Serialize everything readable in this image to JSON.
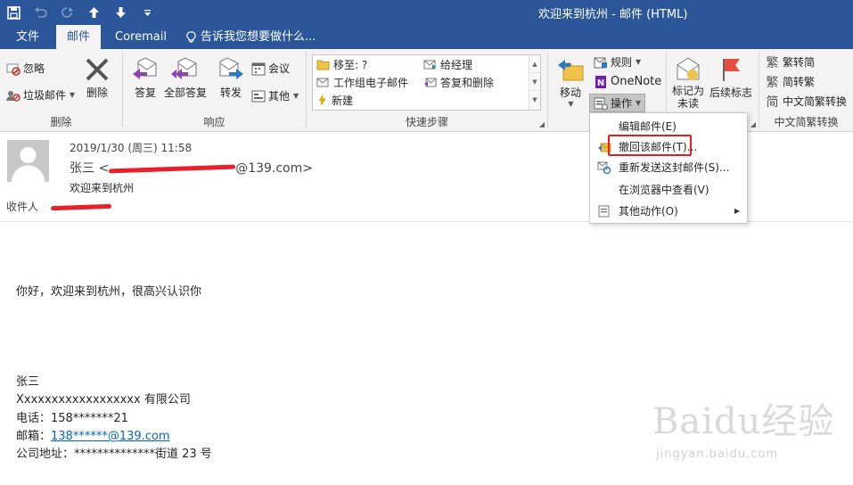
{
  "window": {
    "title": "欢迎来到杭州 - 邮件 (HTML)"
  },
  "qat": {
    "save": "save",
    "undo": "undo",
    "redo": "redo",
    "up": "previous-item",
    "down": "next-item",
    "customize": "customize"
  },
  "tabs": [
    {
      "label": "文件"
    },
    {
      "label": "邮件"
    },
    {
      "label": "Coremail"
    },
    {
      "label": "告诉我您想要做什么..."
    }
  ],
  "ribbon": {
    "delete_group": {
      "label": "删除",
      "ignore": "忽略",
      "junk": "垃圾邮件",
      "delete": "删除"
    },
    "respond_group": {
      "label": "响应",
      "reply": "答复",
      "reply_all": "全部答复",
      "forward": "转发",
      "meeting": "会议",
      "more": "其他"
    },
    "quick_steps": {
      "label": "快速步骤",
      "items": [
        "移至: ?",
        "给经理",
        "工作组电子邮件",
        "答复和删除",
        "新建"
      ]
    },
    "move_group": {
      "move": "移动",
      "rules": "规则",
      "onenote": "OneNote",
      "actions": "操作"
    },
    "tags_group": {
      "mark_unread_1": "标记为",
      "mark_unread_2": "未读",
      "follow_up": "后续标志"
    },
    "convert_group": {
      "label": "中文简繁转换",
      "to_simplified_trad": "繁转简",
      "to_trad": "简转繁",
      "convert": "中文简繁转换"
    }
  },
  "message": {
    "date": "2019/1/30 (周三) 11:58",
    "from_name": "张三 <",
    "from_domain": "@139.com>",
    "subject": "欢迎来到杭州",
    "to_label": "收件人"
  },
  "body": {
    "greeting": "你好，欢迎来到杭州，很高兴认识你",
    "sig_name": "张三",
    "sig_company": "Xxxxxxxxxxxxxxxxxx 有限公司",
    "sig_phone": "电话：158*******21",
    "sig_email_label": "邮箱：",
    "sig_email": "138******@139.com",
    "sig_address": "公司地址：**************街道 23 号"
  },
  "menu": {
    "items": [
      {
        "label": "编辑邮件(E)",
        "icon": ""
      },
      {
        "label": "撤回该邮件(T)...",
        "icon": "recall-icon"
      },
      {
        "label": "重新发送这封邮件(S)...",
        "icon": "resend-icon"
      },
      {
        "label": "在浏览器中查看(V)",
        "icon": ""
      },
      {
        "label": "其他动作(O)",
        "icon": "other-actions-icon"
      }
    ]
  },
  "watermark": {
    "brand": "Baidu经验",
    "url": "jingyan.baidu.com"
  },
  "colors": {
    "brand_blue": "#2b579a",
    "highlight_red": "#e02020",
    "link": "#0563c1"
  }
}
